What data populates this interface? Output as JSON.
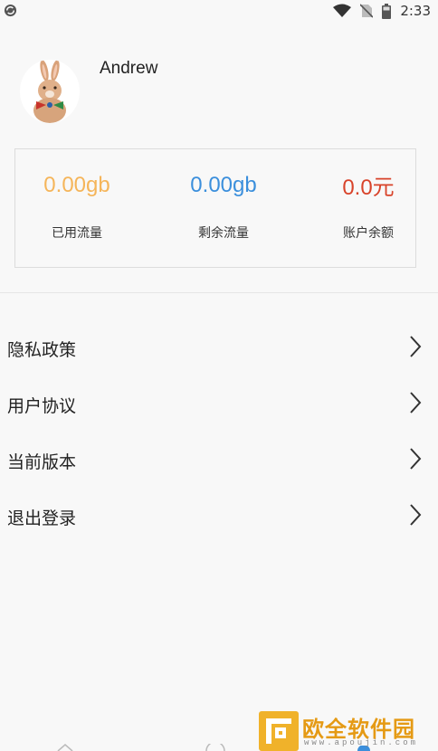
{
  "status_bar": {
    "time": "2:33"
  },
  "profile": {
    "username": "Andrew"
  },
  "stats": [
    {
      "value": "0.00gb",
      "label": "已用流量",
      "color": "#f5b55a"
    },
    {
      "value": "0.00gb",
      "label": "剩余流量",
      "color": "#3b8fdc"
    },
    {
      "value": "0.0元",
      "label": "账户余额",
      "color": "#d8432a"
    }
  ],
  "menu": [
    {
      "label": "隐私政策"
    },
    {
      "label": "用户协议"
    },
    {
      "label": "当前版本"
    },
    {
      "label": "退出登录"
    }
  ],
  "watermark": {
    "title": "欧全软件园",
    "subtitle": "www.apoujin.com"
  }
}
